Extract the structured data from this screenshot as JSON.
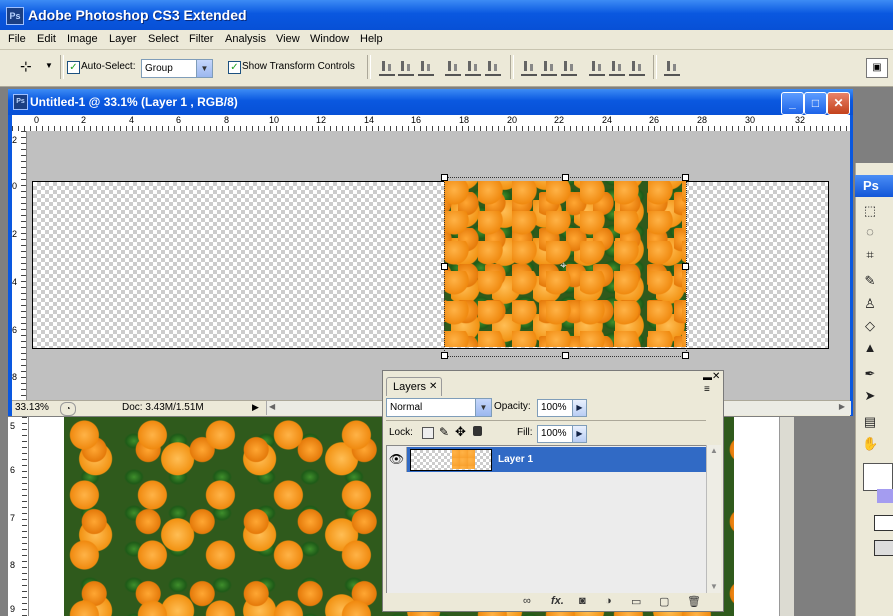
{
  "app": {
    "title": "Adobe Photoshop CS3 Extended",
    "logo": "Ps"
  },
  "menu": [
    "File",
    "Edit",
    "Image",
    "Layer",
    "Select",
    "Filter",
    "Analysis",
    "View",
    "Window",
    "Help"
  ],
  "options": {
    "auto_select_label": "Auto-Select:",
    "auto_select_value": "Group",
    "show_transform_label": "Show Transform Controls"
  },
  "document": {
    "title": "Untitled-1 @ 33.1% (Layer 1 , RGB/8)",
    "zoom": "33.13%",
    "doc_info": "Doc: 3.43M/1.51M",
    "ruler_top": [
      "0",
      "2",
      "4",
      "6",
      "8",
      "10",
      "12",
      "14",
      "16",
      "18",
      "20",
      "22",
      "24",
      "26",
      "28",
      "30",
      "32"
    ],
    "ruler_left": [
      "2",
      "0",
      "2",
      "4",
      "6",
      "8"
    ],
    "bg_ruler_left": [
      "5",
      "6",
      "7",
      "8",
      "9"
    ]
  },
  "window_buttons": {
    "minimize": "_",
    "maximize": "□",
    "close": "✕"
  },
  "tools": {
    "header": "Ps"
  },
  "layers_panel": {
    "tab": "Layers",
    "blend_mode": "Normal",
    "opacity_label": "Opacity:",
    "opacity_value": "100%",
    "lock_label": "Lock:",
    "fill_label": "Fill:",
    "fill_value": "100%",
    "layers": [
      {
        "name": "Layer 1",
        "visible": true,
        "selected": true
      }
    ],
    "footer_fx": "fx."
  },
  "colors": {
    "titlebar": "#0a58e0",
    "selection": "#316ac5",
    "panel": "#ece9d8"
  }
}
